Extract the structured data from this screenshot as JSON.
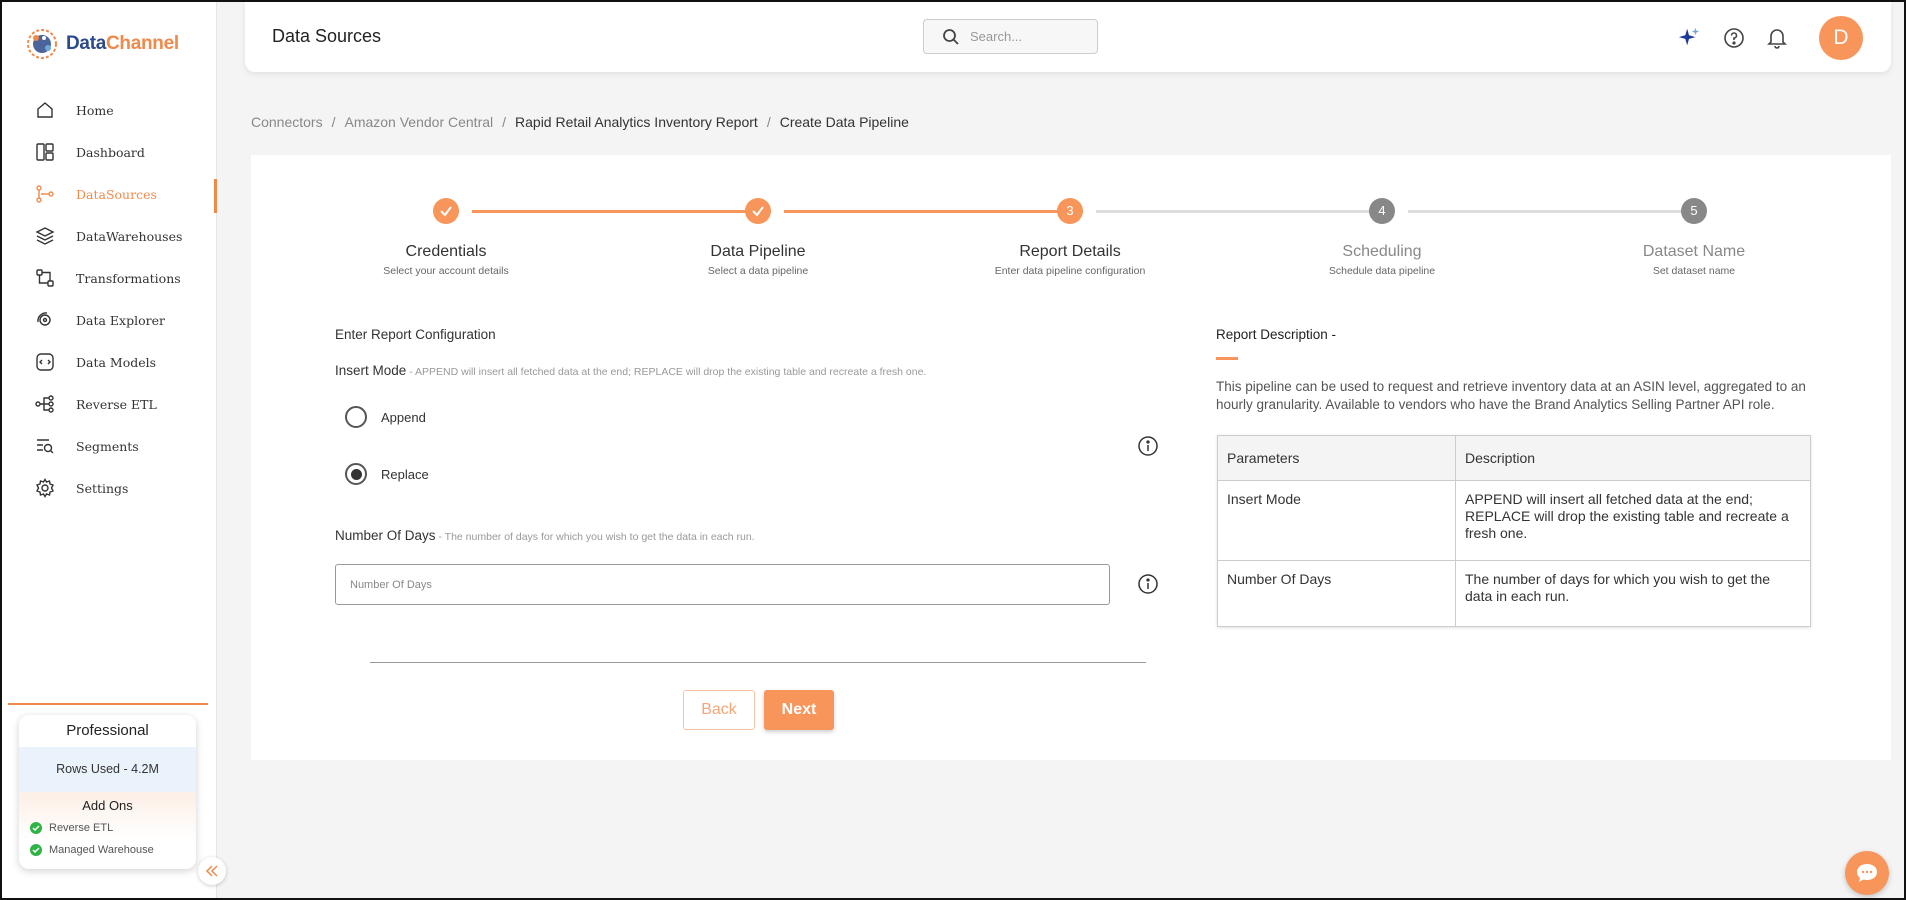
{
  "brand": {
    "name_part1": "Data",
    "name_part2": "Channel",
    "accent": "#f7955b",
    "primary": "#2b4a8b"
  },
  "sidebar": {
    "items": [
      {
        "label": "Home",
        "icon": "home-icon",
        "active": false
      },
      {
        "label": "Dashboard",
        "icon": "dashboard-icon",
        "active": false
      },
      {
        "label": "DataSources",
        "icon": "datasources-icon",
        "active": true
      },
      {
        "label": "DataWarehouses",
        "icon": "layers-icon",
        "active": false
      },
      {
        "label": "Transformations",
        "icon": "transform-icon",
        "active": false
      },
      {
        "label": "Data Explorer",
        "icon": "explorer-icon",
        "active": false
      },
      {
        "label": "Data Models",
        "icon": "models-icon",
        "active": false
      },
      {
        "label": "Reverse ETL",
        "icon": "reverse-etl-icon",
        "active": false
      },
      {
        "label": "Segments",
        "icon": "segments-icon",
        "active": false
      },
      {
        "label": "Settings",
        "icon": "gear-icon",
        "active": false
      }
    ],
    "plan": {
      "title": "Professional",
      "rows_used": "Rows Used - 4.2M",
      "addons_title": "Add Ons",
      "addons": [
        "Reverse ETL",
        "Managed Warehouse"
      ]
    }
  },
  "header": {
    "title": "Data Sources",
    "search_placeholder": "Search...",
    "avatar_letter": "D"
  },
  "breadcrumb": [
    "Connectors",
    "Amazon Vendor Central",
    "Rapid Retail Analytics Inventory Report",
    "Create Data Pipeline"
  ],
  "stepper": [
    {
      "number": "1",
      "label": "Credentials",
      "sub": "Select your account details",
      "status": "done"
    },
    {
      "number": "2",
      "label": "Data Pipeline",
      "sub": "Select a data pipeline",
      "status": "done"
    },
    {
      "number": "3",
      "label": "Report Details",
      "sub": "Enter data pipeline configuration",
      "status": "current"
    },
    {
      "number": "4",
      "label": "Scheduling",
      "sub": "Schedule data pipeline",
      "status": "todo"
    },
    {
      "number": "5",
      "label": "Dataset Name",
      "sub": "Set dataset name",
      "status": "todo"
    }
  ],
  "form": {
    "title": "Enter Report Configuration",
    "insert_mode_label": "Insert Mode",
    "insert_mode_hint": " - APPEND will insert all fetched data at the end; REPLACE will drop the existing table and recreate a fresh one.",
    "options": [
      {
        "label": "Append",
        "selected": false
      },
      {
        "label": "Replace",
        "selected": true
      }
    ],
    "days_label": "Number Of Days",
    "days_hint": " - The number of days for which you wish to get the data in each run.",
    "days_placeholder": "Number Of Days",
    "days_value": "",
    "back_label": "Back",
    "next_label": "Next"
  },
  "report": {
    "title": "Report Description -",
    "description": "This pipeline can be used to request and retrieve inventory data at an ASIN level, aggregated to an hourly granularity. Available to vendors who have the Brand Analytics Selling Partner API role.",
    "table_headers": [
      "Parameters",
      "Description"
    ],
    "table_rows": [
      [
        "Insert Mode",
        "APPEND will insert all fetched data at the end; REPLACE will drop the existing table and recreate a fresh one."
      ],
      [
        "Number Of Days",
        "The number of days for which you wish to get the data in each run."
      ]
    ]
  }
}
